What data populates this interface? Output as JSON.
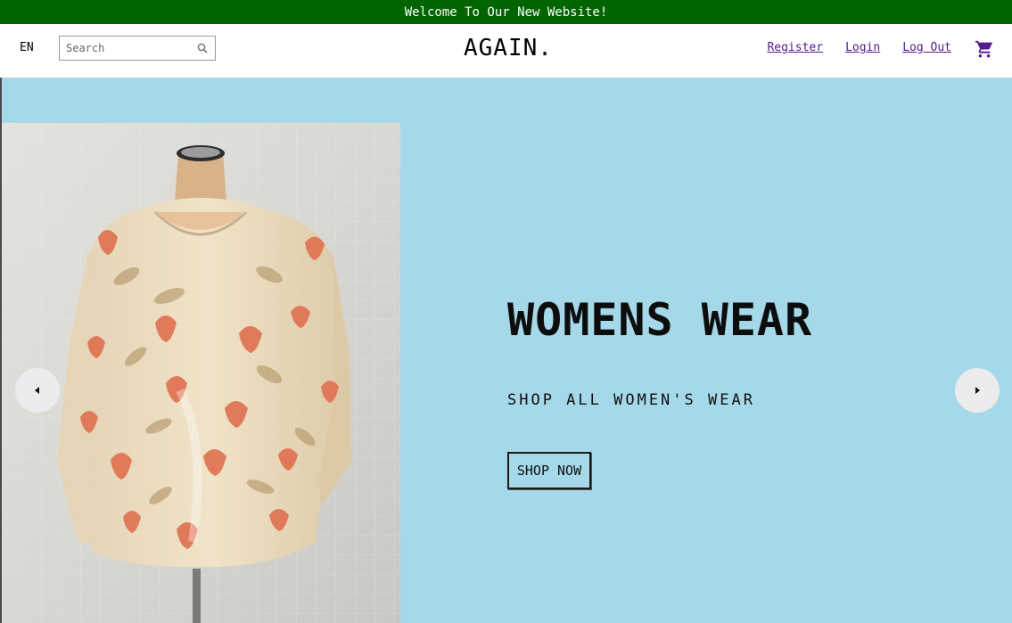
{
  "announcement": {
    "text": "Welcome To Our New Website!",
    "background": "#006400"
  },
  "header": {
    "language": "EN",
    "search": {
      "placeholder": "Search",
      "value": ""
    },
    "logo": "AGAIN.",
    "links": {
      "register": "Register",
      "login": "Login",
      "logout": "Log Out"
    },
    "cart_icon": "shopping-cart-icon",
    "link_color": "#551a8b"
  },
  "hero": {
    "background": "#a5d8e8",
    "title": "WOMENS WEAR",
    "subtitle": "SHOP ALL WOMEN'S WEAR",
    "button_label": "SHOP NOW",
    "prev_icon": "caret-left-icon",
    "next_icon": "caret-right-icon"
  }
}
